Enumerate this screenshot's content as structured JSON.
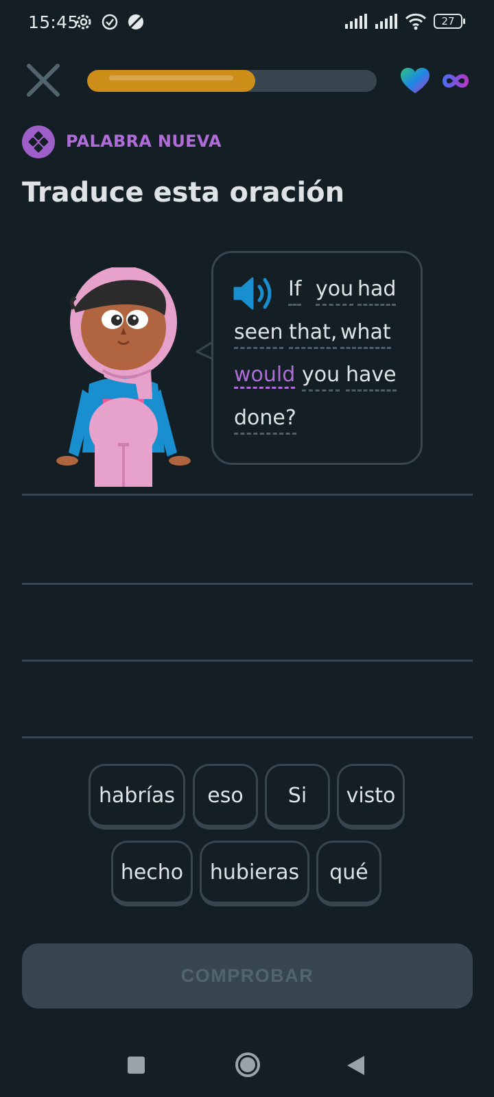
{
  "status_bar": {
    "time": "15:45",
    "battery": "27",
    "icons": [
      "settings-gear-icon",
      "check-circle-icon",
      "data-saver-icon",
      "signal-icon",
      "signal-icon",
      "wifi-icon",
      "battery-icon"
    ]
  },
  "header": {
    "close_icon": "close-icon",
    "progress": 0.58,
    "progress_color": "#ce8f1a",
    "hearts_icon": "heart-icon",
    "hearts_value_icon": "infinity-icon"
  },
  "badge": {
    "label": "PALABRA NUEVA",
    "icon": "new-word-icon",
    "color": "#b06dd9"
  },
  "title": "Traduce esta oración",
  "prompt": {
    "speaker_icon": "speaker-icon",
    "words": [
      {
        "text": "If"
      },
      {
        "text": "you"
      },
      {
        "text": "had"
      },
      {
        "text": "seen"
      },
      {
        "text": "that,"
      },
      {
        "text": "what"
      },
      {
        "text": "would",
        "highlight": true
      },
      {
        "text": "you"
      },
      {
        "text": "have"
      },
      {
        "text": "done?"
      }
    ]
  },
  "word_bank": [
    "habrías",
    "eso",
    "Si",
    "visto",
    "hecho",
    "hubieras",
    "qué"
  ],
  "check_button": {
    "label": "COMPROBAR"
  },
  "nav_bar": {
    "icons": [
      "recents-icon",
      "home-icon",
      "back-icon"
    ]
  }
}
